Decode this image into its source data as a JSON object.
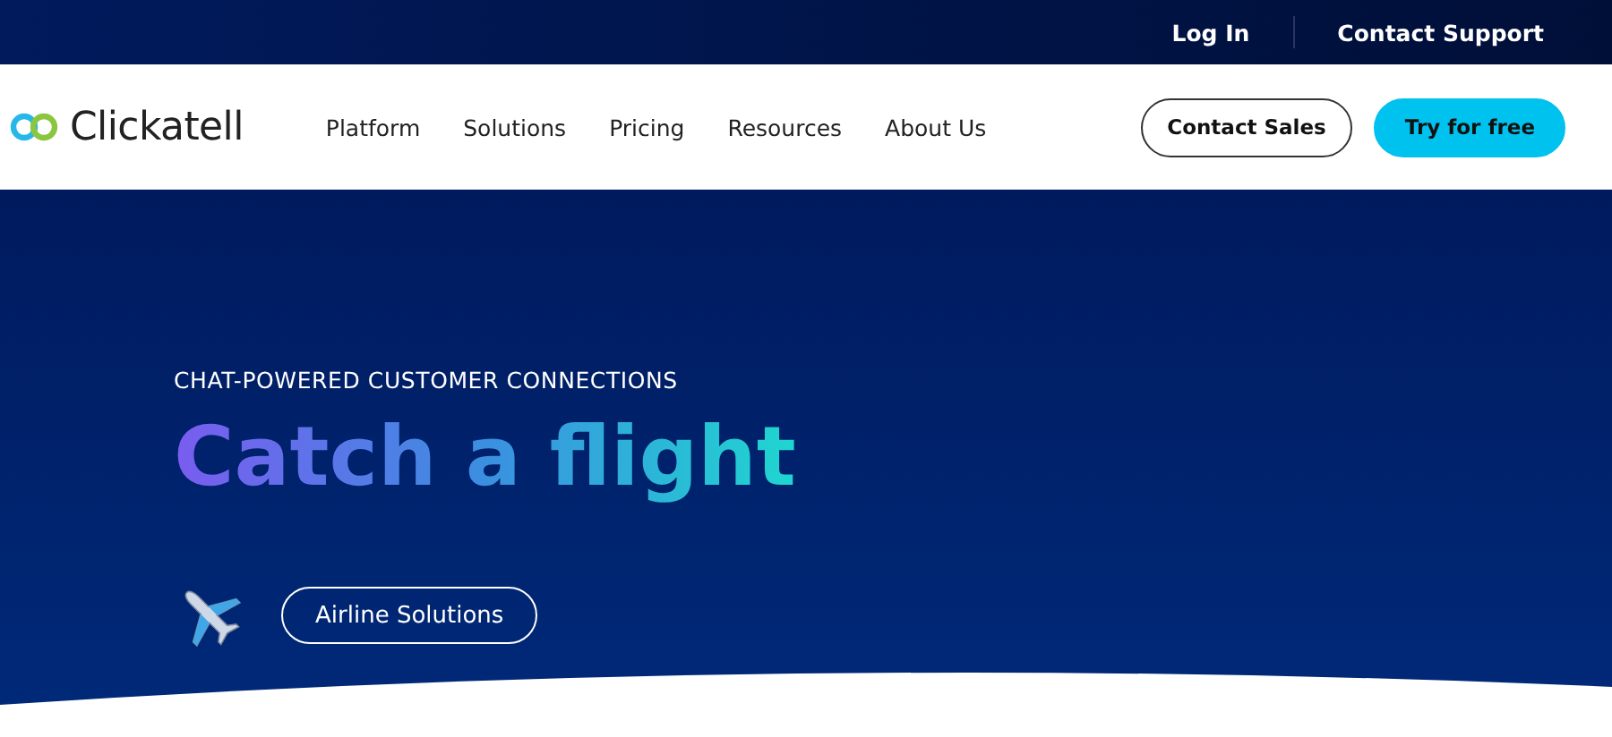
{
  "top_bar": {
    "links": [
      "Log In",
      "Contact Support"
    ]
  },
  "header": {
    "logo": "Clickatell",
    "nav": [
      "Platform",
      "Solutions",
      "Pricing",
      "Resources",
      "About Us"
    ],
    "buttons": [
      {
        "label": "Contact Sales",
        "kind": "outline"
      },
      {
        "label": "Try for free",
        "kind": "filled"
      }
    ]
  },
  "hero": {
    "kicker": "CHAT-POWERED CUSTOMER CONNECTIONS",
    "title": "Catch a flight",
    "button": "Airline Solutions"
  }
}
